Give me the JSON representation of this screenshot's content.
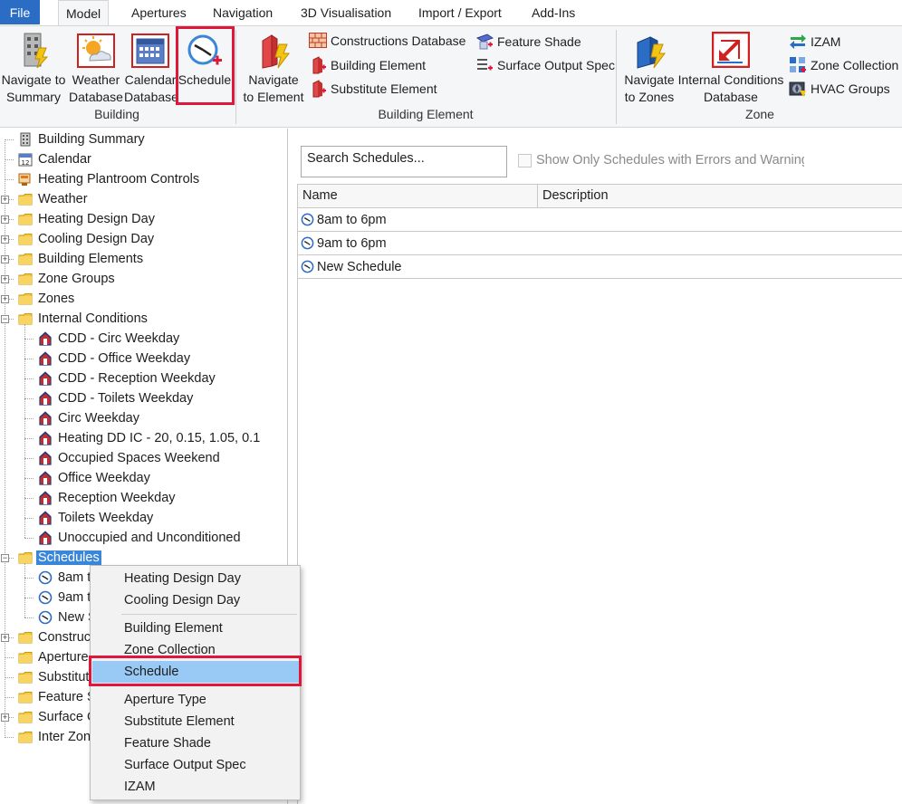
{
  "tabs": {
    "file": "File",
    "model": "Model",
    "apertures": "Apertures",
    "navigation": "Navigation",
    "visualisation": "3D Visualisation",
    "import_export": "Import / Export",
    "addins": "Add-Ins"
  },
  "ribbon": {
    "building": {
      "navigate_summary": [
        "Navigate to",
        "Summary"
      ],
      "weather_db": [
        "Weather",
        "Database"
      ],
      "calendar_db": [
        "Calendar",
        "Database"
      ],
      "schedule": "Schedule",
      "group": "Building"
    },
    "building_element": {
      "navigate_element": [
        "Navigate",
        "to Element"
      ],
      "constructions_db": "Constructions Database",
      "building_element": "Building Element",
      "substitute_element": "Substitute Element",
      "feature_shade": "Feature Shade",
      "surface_output_spec": "Surface Output Spec",
      "group": "Building Element"
    },
    "zone": {
      "navigate_zones": [
        "Navigate",
        "to Zones"
      ],
      "internal_conditions_db": [
        "Internal Conditions",
        "Database"
      ],
      "izam": "IZAM",
      "zone_collection": "Zone Collection",
      "hvac_groups": "HVAC Groups",
      "group": "Zone"
    }
  },
  "tree": [
    {
      "label": "Building Summary",
      "icon": "building-icon"
    },
    {
      "label": "Calendar",
      "icon": "calendar-icon"
    },
    {
      "label": "Heating Plantroom Controls",
      "icon": "plantroom-icon"
    },
    {
      "label": "Weather",
      "icon": "folder-icon"
    },
    {
      "label": "Heating Design Day",
      "icon": "folder-icon"
    },
    {
      "label": "Cooling Design Day",
      "icon": "folder-icon"
    },
    {
      "label": "Building Elements",
      "icon": "folder-icon"
    },
    {
      "label": "Zone Groups",
      "icon": "folder-icon"
    },
    {
      "label": "Zones",
      "icon": "folder-icon"
    },
    {
      "label": "Internal Conditions",
      "icon": "folder-icon"
    },
    {
      "label": "CDD - Circ Weekday",
      "icon": "house-icon"
    },
    {
      "label": "CDD - Office Weekday",
      "icon": "house-icon"
    },
    {
      "label": "CDD - Reception Weekday",
      "icon": "house-icon"
    },
    {
      "label": "CDD - Toilets Weekday",
      "icon": "house-icon"
    },
    {
      "label": "Circ Weekday",
      "icon": "house-icon"
    },
    {
      "label": "Heating DD IC - 20, 0.15, 1.05, 0.1",
      "icon": "house-icon"
    },
    {
      "label": "Occupied Spaces Weekend",
      "icon": "house-icon"
    },
    {
      "label": "Office Weekday",
      "icon": "house-icon"
    },
    {
      "label": "Reception Weekday",
      "icon": "house-icon"
    },
    {
      "label": "Toilets Weekday",
      "icon": "house-icon"
    },
    {
      "label": "Unoccupied and Unconditioned",
      "icon": "house-icon"
    },
    {
      "label": "Schedules",
      "icon": "folder-icon"
    },
    {
      "label": "8am t",
      "icon": "clock-icon"
    },
    {
      "label": "9am t",
      "icon": "clock-icon"
    },
    {
      "label": "New S",
      "icon": "clock-icon"
    },
    {
      "label": "Construct",
      "icon": "folder-icon"
    },
    {
      "label": "Aperture",
      "icon": "folder-icon"
    },
    {
      "label": "Substitut",
      "icon": "folder-icon"
    },
    {
      "label": "Feature S",
      "icon": "folder-icon"
    },
    {
      "label": "Surface C",
      "icon": "folder-icon"
    },
    {
      "label": "Inter Zon",
      "icon": "folder-icon"
    }
  ],
  "search": {
    "placeholder": "Search Schedules..."
  },
  "filter_label": "Show Only Schedules with Errors and Warnings",
  "table": {
    "columns": [
      "Name",
      "Description"
    ],
    "rows": [
      {
        "name": "8am to 6pm",
        "description": ""
      },
      {
        "name": "9am to 6pm",
        "description": ""
      },
      {
        "name": "New Schedule",
        "description": ""
      }
    ]
  },
  "context_menu": {
    "items": [
      "Heating Design Day",
      "Cooling Design Day",
      "Building Element",
      "Zone Collection",
      "Schedule",
      "Aperture Type",
      "Substitute Element",
      "Feature Shade",
      "Surface Output Spec",
      "IZAM"
    ],
    "hovered": "Schedule"
  },
  "colors": {
    "accent": "#2b6cc4",
    "selection": "#3a86d8",
    "menu_hover": "#99c9f5",
    "highlight_red": "#e0173a",
    "folder": "#f5c842"
  }
}
